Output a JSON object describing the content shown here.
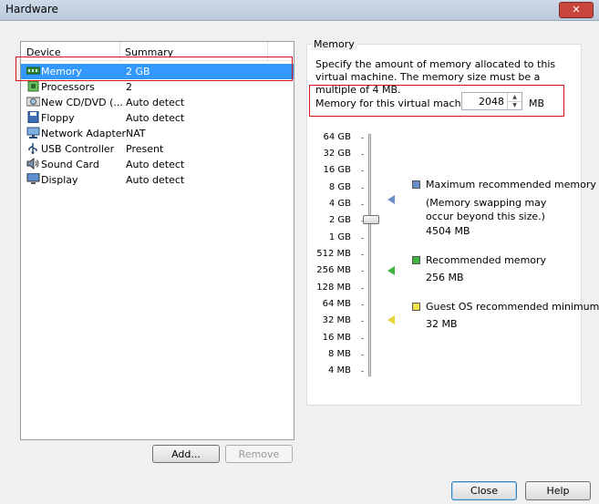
{
  "window": {
    "title": "Hardware"
  },
  "device_list": {
    "headers": {
      "device": "Device",
      "summary": "Summary"
    },
    "items": [
      {
        "device": "Memory",
        "summary": "2 GB",
        "icon": "memory-icon",
        "selected": true
      },
      {
        "device": "Processors",
        "summary": "2",
        "icon": "processor-icon"
      },
      {
        "device": "New CD/DVD (...",
        "summary": "Auto detect",
        "icon": "cd-dvd-icon"
      },
      {
        "device": "Floppy",
        "summary": "Auto detect",
        "icon": "floppy-icon"
      },
      {
        "device": "Network Adapter",
        "summary": "NAT",
        "icon": "network-adapter-icon"
      },
      {
        "device": "USB Controller",
        "summary": "Present",
        "icon": "usb-icon"
      },
      {
        "device": "Sound Card",
        "summary": "Auto detect",
        "icon": "sound-card-icon"
      },
      {
        "device": "Display",
        "summary": "Auto detect",
        "icon": "display-icon"
      }
    ]
  },
  "buttons": {
    "add": "Add...",
    "remove": "Remove",
    "close": "Close",
    "help": "Help"
  },
  "memory": {
    "group_label": "Memory",
    "description": "Specify the amount of memory allocated to this virtual machine. The memory size must be a multiple of 4 MB.",
    "field_label": "Memory for this virtual machine:",
    "value": "2048",
    "unit": "MB",
    "scale": [
      "64 GB",
      "32 GB",
      "16 GB",
      "8 GB",
      "4 GB",
      "2 GB",
      "1 GB",
      "512 MB",
      "256 MB",
      "128 MB",
      "64 MB",
      "32 MB",
      "16 MB",
      "8 MB",
      "4 MB"
    ],
    "legend": {
      "max": {
        "title": "Maximum recommended memory",
        "note": "(Memory swapping may occur beyond this size.)",
        "value": "4504 MB",
        "color": "#6a8fc8"
      },
      "recommended": {
        "title": "Recommended memory",
        "value": "256 MB",
        "color": "#3fb33f"
      },
      "guest": {
        "title": "Guest OS recommended minimum",
        "value": "32 MB",
        "color": "#f0e04a"
      }
    }
  },
  "colors": {
    "selection": "#3399ff",
    "highlight_border": "#d80f1a"
  }
}
